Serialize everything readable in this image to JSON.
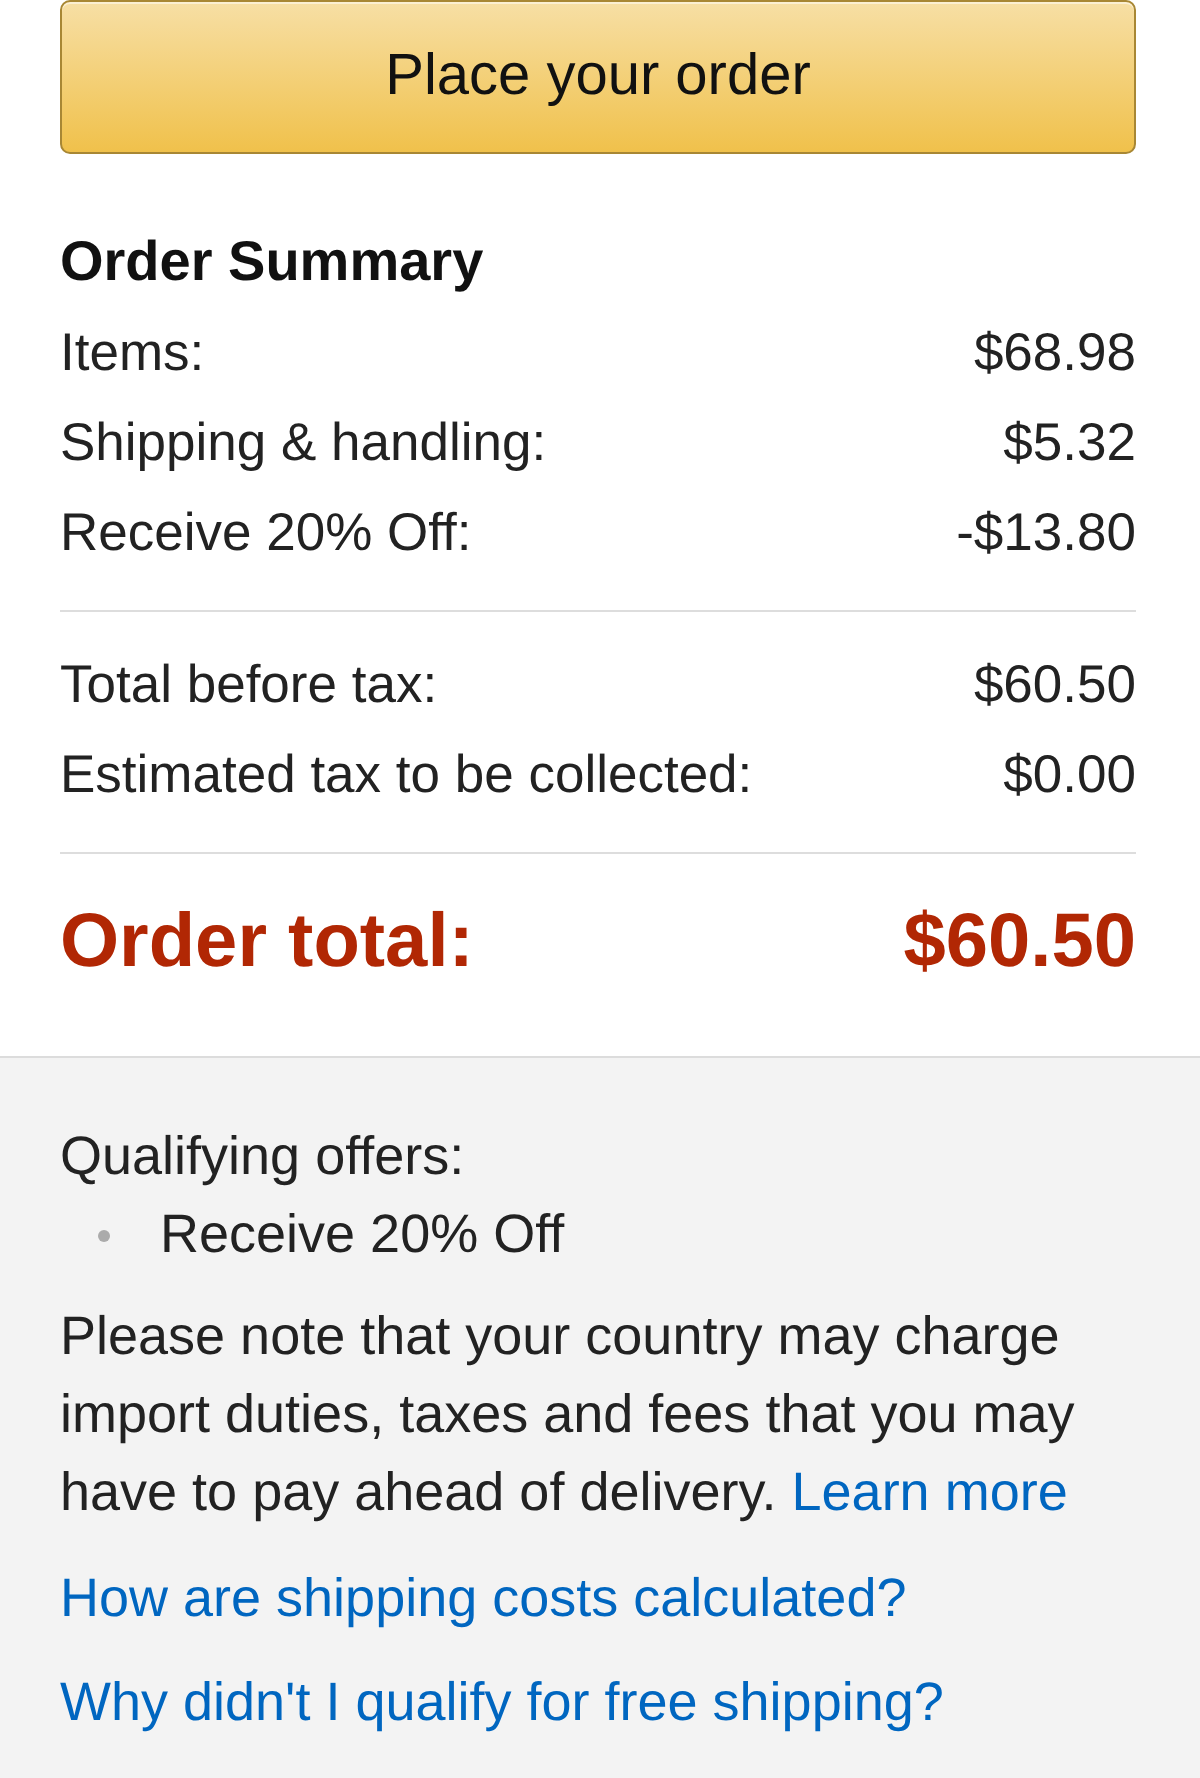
{
  "place_order_button": {
    "label": "Place your order"
  },
  "order_summary": {
    "title": "Order Summary",
    "sections": [
      {
        "rows": [
          {
            "label": "Items:",
            "amount": "$68.98"
          },
          {
            "label": "Shipping & handling:",
            "amount": "$5.32"
          },
          {
            "label": "Receive 20% Off:",
            "amount": "-$13.80"
          }
        ]
      },
      {
        "rows": [
          {
            "label": "Total before tax:",
            "amount": "$60.50"
          },
          {
            "label": "Estimated tax to be collected:",
            "amount": "$0.00"
          }
        ]
      }
    ],
    "total": {
      "label": "Order total:",
      "amount": "$60.50"
    }
  },
  "offers": {
    "title": "Qualifying offers:",
    "items": [
      "Receive 20% Off"
    ]
  },
  "notice": {
    "text": "Please note that your country may charge import duties, taxes and fees that you may have to pay ahead of delivery.",
    "link": "Learn more"
  },
  "help_links": [
    "How are shipping costs calculated?",
    "Why didn't I qualify for free shipping?"
  ]
}
